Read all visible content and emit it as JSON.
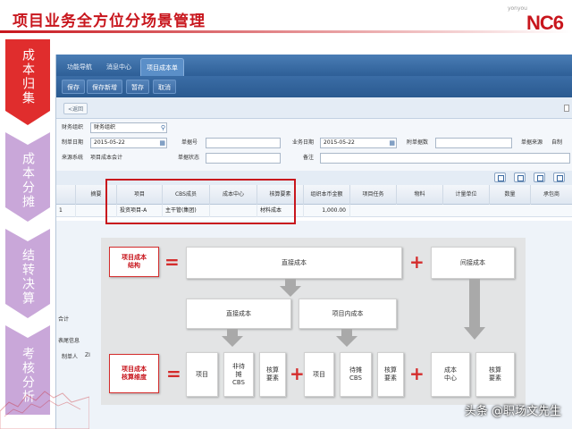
{
  "header": {
    "title": "项目业务全方位分场景管理",
    "brand_small": "yonyou",
    "brand": "NC6"
  },
  "nav": {
    "items": [
      {
        "label": "成本归集",
        "color": "#e02d2d"
      },
      {
        "label": "成本分摊",
        "color": "#c9a7d9"
      },
      {
        "label": "结转决算",
        "color": "#c9a7d9"
      },
      {
        "label": "考核分析",
        "color": "#c9a7d9"
      }
    ]
  },
  "app": {
    "tabs": [
      "功能导航",
      "消息中心",
      "项目成本单"
    ],
    "toolbar": [
      "保存",
      "保存新增",
      "暂存",
      "取消"
    ],
    "back": "<返回",
    "form": {
      "org_label": "财务组织",
      "org_value": "财务组织",
      "doc_date_label": "制单日期",
      "doc_date_value": "2015-05-22",
      "doc_no_label": "单据号",
      "biz_date_label": "业务日期",
      "biz_date_value": "2015-05-22",
      "attach_label": "附单据数",
      "source_label": "单据来源",
      "source_value": "自制",
      "source_sys_label": "来源系统",
      "source_sys_value": "项目成本会计",
      "doc_status_label": "单据状态",
      "remark_label": "备注"
    },
    "grid": {
      "headers": [
        "摘要",
        "项目",
        "CBS成员",
        "成本中心",
        "核算要素",
        "组织本币金额",
        "项目任务",
        "物料",
        "计量单位",
        "数量",
        "承包商"
      ],
      "row": {
        "no": "1",
        "project": "投资项目-A",
        "cbs": "主干管(集团)",
        "center": "",
        "element": "材料成本",
        "amount": "1,000.00"
      }
    },
    "footer": {
      "total": "合计",
      "tail": "表尾信息",
      "maker": "制单人",
      "maker_value": "ZI"
    }
  },
  "diagram": {
    "row1_left": "项目成本\n结构",
    "row1_mid": "直接成本",
    "row1_right": "间接成本",
    "row2_a": "直接成本",
    "row2_b": "项目内成本",
    "row3_left": "项目成本\n核算维度",
    "row3_items": [
      "项目",
      "非待\n摊\nCBS",
      "核算\n要素",
      "项目",
      "待摊\nCBS",
      "核算\n要素",
      "成本\n中心",
      "核算\n要素"
    ],
    "equals": "=",
    "plus": "+"
  },
  "watermark": "头条 @职场文先生"
}
